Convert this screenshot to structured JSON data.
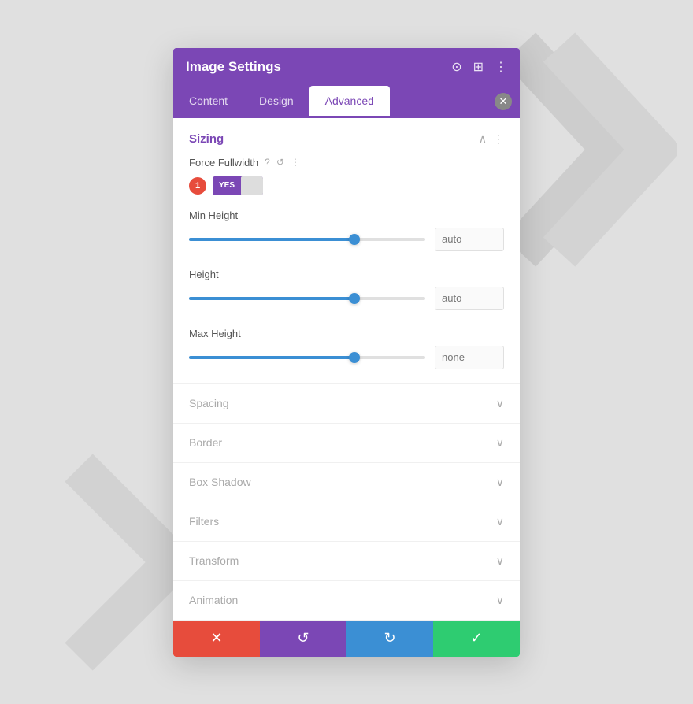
{
  "background": {
    "color": "#e8e8e8"
  },
  "modal": {
    "title": "Image Settings",
    "tabs": [
      {
        "id": "content",
        "label": "Content",
        "active": false
      },
      {
        "id": "design",
        "label": "Design",
        "active": false
      },
      {
        "id": "advanced",
        "label": "Advanced",
        "active": true
      }
    ],
    "sections": {
      "sizing": {
        "title": "Sizing",
        "fields": {
          "force_fullwidth": {
            "label": "Force Fullwidth",
            "toggle_yes": "YES",
            "badge": "1"
          },
          "min_height": {
            "label": "Min Height",
            "value": "auto",
            "slider_pct": 70
          },
          "height": {
            "label": "Height",
            "value": "auto",
            "slider_pct": 70
          },
          "max_height": {
            "label": "Max Height",
            "value": "none",
            "slider_pct": 70
          }
        }
      },
      "collapsed": [
        {
          "id": "spacing",
          "label": "Spacing"
        },
        {
          "id": "border",
          "label": "Border"
        },
        {
          "id": "box-shadow",
          "label": "Box Shadow"
        },
        {
          "id": "filters",
          "label": "Filters"
        },
        {
          "id": "transform",
          "label": "Transform"
        },
        {
          "id": "animation",
          "label": "Animation"
        }
      ]
    },
    "footer": {
      "cancel_icon": "✕",
      "undo_icon": "↺",
      "redo_icon": "↻",
      "save_icon": "✓"
    }
  }
}
